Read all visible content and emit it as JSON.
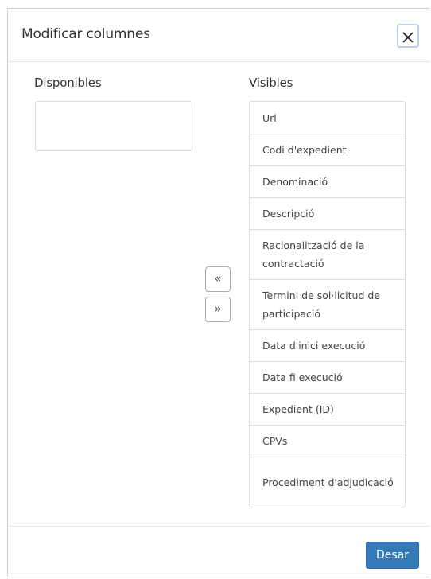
{
  "dialog": {
    "title": "Modificar columnes",
    "close_icon": "close-icon"
  },
  "available": {
    "label": "Disponibles",
    "items": []
  },
  "visible": {
    "label": "Visibles",
    "items": [
      "Url",
      "Codi d'expedient",
      "Denominació",
      "Descripció",
      "Racionalització de la contractació",
      "Termini de sol·licitud de participació",
      "Data d'inici execució",
      "Data fi execució",
      "Expedient (ID)",
      "CPVs",
      "Procediment d'adjudicació"
    ]
  },
  "transfer": {
    "move_left": "«",
    "move_right": "»"
  },
  "footer": {
    "save_label": "Desar"
  },
  "colors": {
    "primary": "#337ab7",
    "border": "#dddddd",
    "close_focus": "#b9cfe6"
  }
}
